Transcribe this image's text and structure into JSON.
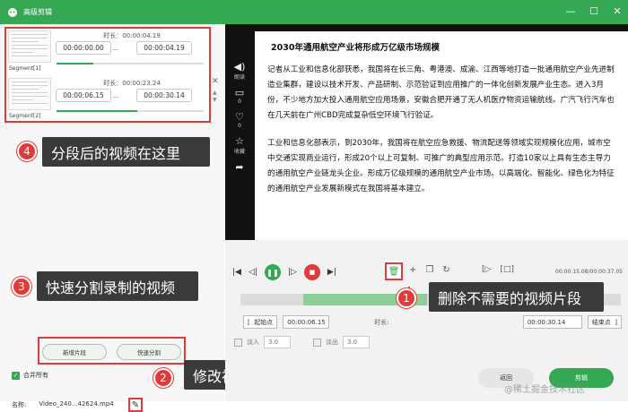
{
  "window": {
    "title": "高级剪辑"
  },
  "segments": [
    {
      "duration_label": "时长：",
      "duration": "00:00:04.19",
      "start": "00:00:00.00",
      "end": "00:00:04.19",
      "name": "Segment[1]",
      "progress": 0.25
    },
    {
      "duration_label": "时长：",
      "duration": "00:00:23.24",
      "start": "00:00:06.15",
      "end": "00:00:30.14",
      "name": "Segment[2]",
      "progress": 0.55
    }
  ],
  "callouts": {
    "c4": {
      "num": "4",
      "text": "分段后的视频在这里"
    },
    "c3": {
      "num": "3",
      "text": "快速分割录制的视频"
    },
    "c1": {
      "num": "1",
      "text": "删除不需要的视频片段"
    },
    "c2": {
      "num": "2",
      "text": "修改视频的名称"
    }
  },
  "left_buttons": {
    "new_segment": "新增片段",
    "quick_split": "快速分割"
  },
  "merge_all": "合并所有",
  "name_row": {
    "label": "名称:",
    "value": "Video_240...42624.mp4"
  },
  "document": {
    "heading": "2030年通用航空产业将形成万亿级市场规模",
    "p1": "记者从工业和信息化部获悉，我国将在长三角、粤港澳、成渝、江西等地打造一批通用航空产业先进制造业集群，建设以技术开发、产品研制、示范验证到应用推广的一体化创新发展产业生态。进入3月份，不少地方加大投入通用航空应用场景，安徽合肥开通了无人机医疗物资运输航线。广汽飞行汽车也在几天前在广州CBD完成复杂低空环境飞行验证。",
    "p2": "工业和信息化部表示，到2030年，我国将在航空应急救援、物流配送等领域实现规模化应用，城市空中交通实现商业运行，形成20个以上可复制、可推广的典型应用示范。打造10家以上具有生态主导力的通用航空产业链龙头企业。形成万亿级规模的通用航空产业市场。以高端化、智能化、绿色化为特征的通用航空产业发展新模式在我国将基本建立。"
  },
  "doc_sidebar": [
    {
      "icon": "speaker-icon",
      "label": "朗读"
    },
    {
      "icon": "comment-icon",
      "label": "0"
    },
    {
      "icon": "thumbs-up-icon",
      "label": "0"
    },
    {
      "icon": "star-icon",
      "label": "收藏"
    },
    {
      "icon": "share-icon",
      "label": ""
    }
  ],
  "player": {
    "time": "00:00:15.08/00:00:37.05"
  },
  "position": {
    "start_label": "起始点",
    "start_value": "00:00:06.15",
    "current_label": "时长:",
    "end_value": "00:00:30.14",
    "end_label": "结束点"
  },
  "fade": {
    "in_label": "淡入",
    "in_value": "3.0",
    "out_label": "淡出",
    "out_value": "3.0"
  },
  "actions": {
    "back": "返回",
    "clip": "剪辑"
  },
  "watermark": "@稀土掘金技术社区"
}
